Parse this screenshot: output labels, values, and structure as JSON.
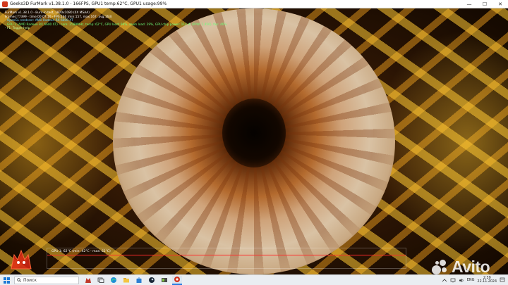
{
  "window": {
    "title": "Geeks3D FurMark v1.38.1.0 - 166FPS, GPU1 temp:62°C, GPU1 usage:99%",
    "minimize_glyph": "—",
    "maximize_glyph": "☐",
    "close_glyph": "✕"
  },
  "osd": {
    "line1": "FurMark v1.38.1.0 - Burn-in test, 1920x1080 (0X MSAA)",
    "line2": "Frames:77399 - time:00:07:10 - FPS:166 (min:157, max:167, avg:163)",
    "line3": "- OpenGL renderer: AMD Radeon RX 6600 XT",
    "line4": "- GPU 1 (AMD Radeon RX 6600 XT) - core: 2589MHz, temp: 62°C, GPU load: 99%, mem load: 29%, GPU chip power: 114 W (PPW: 1.456), fan: 46%",
    "line5": "- F1: Toggle help"
  },
  "temp_graph": {
    "label": "GPU 1: 62°C (min: 42°C - max: 62°C)"
  },
  "watermark": {
    "text": "Avito"
  },
  "taskbar": {
    "search_label": "Поиск",
    "tray_lang": "ENG",
    "clock_time": "2:39",
    "clock_date": "22.11.2024"
  },
  "icons": {
    "start": "windows-logo-icon",
    "search": "search-icon",
    "apps": [
      "furmark-wolf-icon",
      "task-view-icon",
      "edge-icon",
      "file-explorer-icon",
      "store-icon",
      "steam-icon",
      "gpu-z-icon",
      "furmark-icon"
    ]
  },
  "colors": {
    "osd_white": "#ffffff",
    "osd_cyan": "#6fd8ff",
    "osd_green": "#6dff7a",
    "graph_curve": "#ff2a2a",
    "taskbar_bg": "#eaeef2"
  }
}
